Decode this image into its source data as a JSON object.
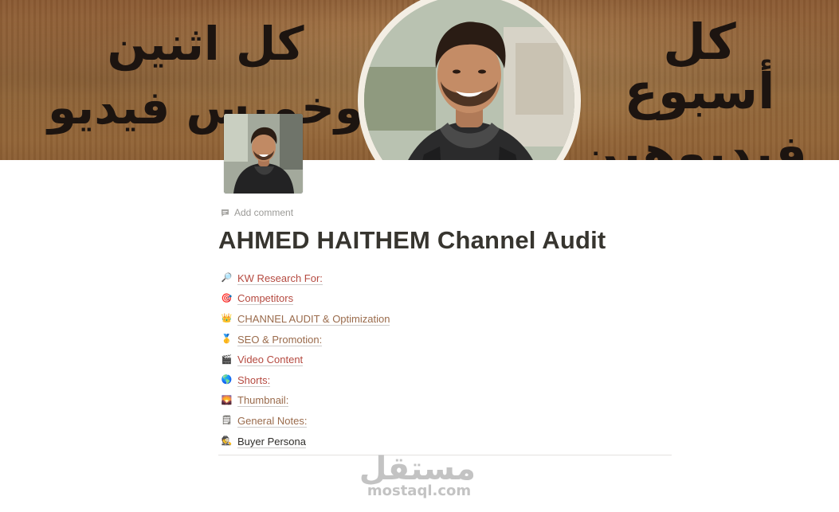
{
  "cover": {
    "left_text": [
      "كل اثنين",
      "وخميس فيديو"
    ],
    "right_text": [
      "كل أسبوع",
      "فيديوهين"
    ]
  },
  "actions": {
    "add_comment": "Add comment"
  },
  "page": {
    "title": "AHMED HAITHEM Channel Audit"
  },
  "links": [
    {
      "icon": "magnifier-icon",
      "emoji": "🔎",
      "label": "KW Research For:",
      "color": "#b54a40"
    },
    {
      "icon": "target-icon",
      "emoji": "🎯",
      "label": "Competitors",
      "color": "#b54a40"
    },
    {
      "icon": "crown-icon",
      "emoji": "👑",
      "label": "CHANNEL AUDIT & Optimization",
      "color": "#9a6b4c"
    },
    {
      "icon": "medal-icon",
      "emoji": "🥇",
      "label": "SEO & Promotion:",
      "color": "#9a6b4c"
    },
    {
      "icon": "clapper-icon",
      "emoji": "🎬",
      "label": "Video Content",
      "color": "#b54a40"
    },
    {
      "icon": "globe-icon",
      "emoji": "🌎",
      "label": "Shorts:",
      "color": "#b54a40"
    },
    {
      "icon": "image-icon",
      "emoji": "🌄",
      "label": "Thumbnail:",
      "color": "#9a6b4c"
    },
    {
      "icon": "notepad-icon",
      "emoji": "🗒",
      "label": "General Notes:",
      "color": "#9a6b4c"
    },
    {
      "icon": "detective-icon",
      "emoji": "🕵",
      "label": "Buyer Persona",
      "color": "#2f2d2a"
    }
  ],
  "watermark": {
    "arabic": "مستقل",
    "latin": "mostaql.com"
  },
  "colors": {
    "link_red": "#b54a40",
    "link_brown": "#9a6b4c",
    "title": "#37352f",
    "muted": "#9b9a97"
  }
}
